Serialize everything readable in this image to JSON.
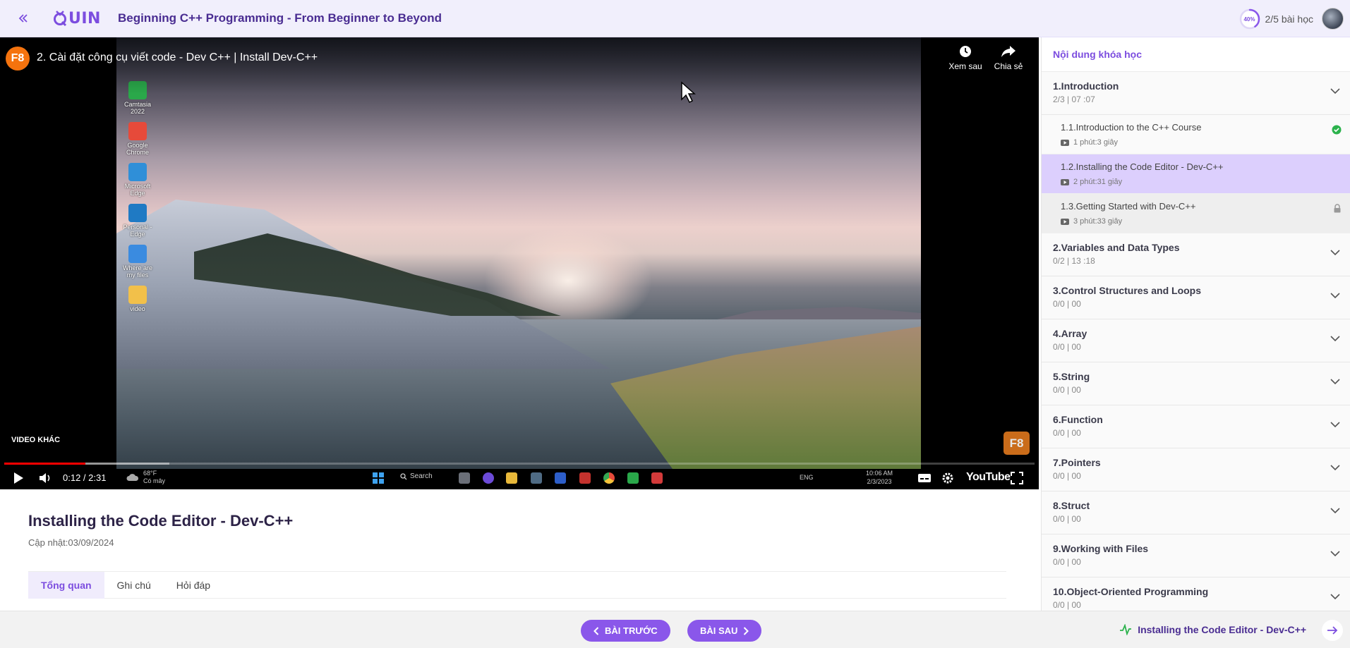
{
  "header": {
    "logo_text": "Quin",
    "course_title": "Beginning C++ Programming - From Beginner to Beyond",
    "progress_percent_label": "40%",
    "progress_percent": 40,
    "progress_text": "2/5 bài học"
  },
  "video": {
    "channel_badge": "F8",
    "title": "2. Cài đặt công cụ viết code - Dev C++ | Install Dev-C++",
    "watch_later_label": "Xem sau",
    "share_label": "Chia sẻ",
    "more_videos_label": "VIDEO KHÁC",
    "watermark": "F8",
    "time_display": "0:12 / 2:31",
    "played_fraction": 0.079,
    "buffered_fraction": 0.16,
    "youtube_label": "YouTube",
    "desktop_icons": [
      {
        "label": "Camtasia 2022",
        "color": "#2aa84a"
      },
      {
        "label": "Google Chrome",
        "color": "#e64a3a"
      },
      {
        "label": "Microsoft Edge",
        "color": "#2f8fd8"
      },
      {
        "label": "Personal - Edge",
        "color": "#1f7ac4"
      },
      {
        "label": "Where are my files",
        "color": "#3a8be0"
      },
      {
        "label": "video",
        "color": "#f2c04a"
      }
    ],
    "taskbar": {
      "weather_temp": "68°F",
      "weather_desc": "Có mây",
      "search_label": "Search",
      "lang": "ENG",
      "clock_time": "10:06 AM",
      "clock_date": "2/3/2023"
    }
  },
  "lesson": {
    "title": "Installing the Code Editor - Dev-C++",
    "updated": "Cập nhật:03/09/2024",
    "tabs": [
      {
        "label": "Tổng quan",
        "active": true
      },
      {
        "label": "Ghi chú",
        "active": false
      },
      {
        "label": "Hỏi đáp",
        "active": false
      }
    ]
  },
  "sidebar": {
    "heading": "Nội dung khóa học",
    "sections": [
      {
        "title": "1.Introduction",
        "meta": "2/3  |  07 :07",
        "expanded": true,
        "lessons": [
          {
            "title": "1.1.Introduction to the C++ Course",
            "duration": "1 phút:3 giây",
            "status": "done"
          },
          {
            "title": "1.2.Installing the Code Editor - Dev-C++",
            "duration": "2 phút:31 giây",
            "status": "active"
          },
          {
            "title": "1.3.Getting Started with Dev-C++",
            "duration": "3 phút:33 giây",
            "status": "locked"
          }
        ]
      },
      {
        "title": "2.Variables and Data Types",
        "meta": "0/2  |  13 :18"
      },
      {
        "title": "3.Control Structures and Loops",
        "meta": "0/0  |  00"
      },
      {
        "title": "4.Array",
        "meta": "0/0  |  00"
      },
      {
        "title": "5.String",
        "meta": "0/0  |  00"
      },
      {
        "title": "6.Function",
        "meta": "0/0  |  00"
      },
      {
        "title": "7.Pointers",
        "meta": "0/0  |  00"
      },
      {
        "title": "8.Struct",
        "meta": "0/0  |  00"
      },
      {
        "title": "9.Working with Files",
        "meta": "0/0  |  00"
      },
      {
        "title": "10.Object-Oriented Programming",
        "meta": "0/0  |  00"
      }
    ]
  },
  "bottom": {
    "prev_label": "BÀI TRƯỚC",
    "next_label": "BÀI SAU",
    "current_lesson": "Installing the Code Editor - Dev-C++"
  },
  "colors": {
    "accent": "#7c4ddf",
    "button": "#8a57ea",
    "active_lesson_bg": "#dccffd",
    "done_green": "#2bb24c",
    "header_bg": "#f1effc"
  }
}
